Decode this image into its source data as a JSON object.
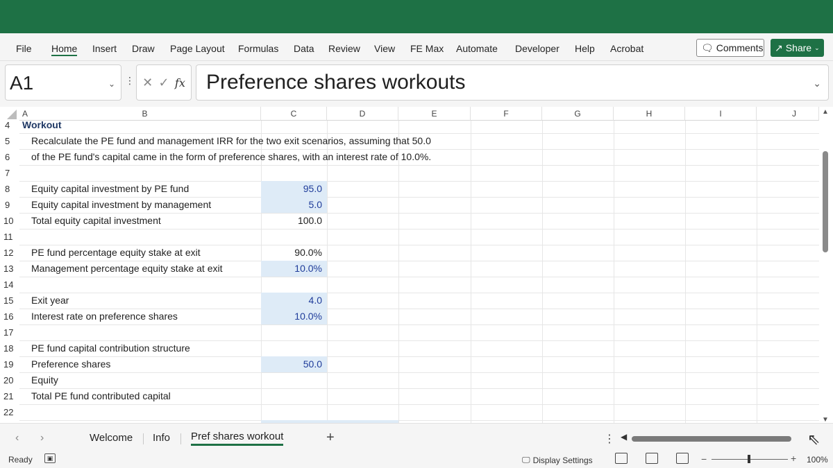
{
  "ribbon": {
    "tabs": [
      "File",
      "Home",
      "Insert",
      "Draw",
      "Page Layout",
      "Formulas",
      "Data",
      "Review",
      "View",
      "FE Max",
      "Automate",
      "Developer",
      "Help",
      "Acrobat"
    ],
    "active_tab": "Home",
    "comments_label": "Comments",
    "share_label": "Share"
  },
  "formula_bar": {
    "name_box": "A1",
    "fx": "fx",
    "formula": "Preference shares workouts"
  },
  "grid": {
    "columns": [
      "A",
      "B",
      "C",
      "D",
      "E",
      "F",
      "G",
      "H",
      "I",
      "J"
    ],
    "rows": [
      "4",
      "5",
      "6",
      "7",
      "8",
      "9",
      "10",
      "11",
      "12",
      "13",
      "14",
      "15",
      "16",
      "17",
      "18",
      "19",
      "20",
      "21",
      "22"
    ],
    "cells": {
      "r4_title": "Workout",
      "r5_text": "Recalculate the PE fund and management IRR for the two exit scenarios, assuming that 50.0",
      "r6_text": "of the PE fund's capital came in the form of preference shares, with an interest rate of 10.0%.",
      "r8_label": "Equity capital investment by PE fund",
      "r8_value": "95.0",
      "r9_label": "Equity capital investment by management",
      "r9_value": "5.0",
      "r10_label": "Total equity capital investment",
      "r10_value": "100.0",
      "r12_label": "PE fund percentage equity stake at exit",
      "r12_value": "90.0%",
      "r13_label": "Management percentage equity stake at exit",
      "r13_value": "10.0%",
      "r15_label": "Exit year",
      "r15_value": "4.0",
      "r16_label": "Interest rate on preference shares",
      "r16_value": "10.0%",
      "r18_label": "PE fund capital contribution structure",
      "r19_label": "Preference shares",
      "r19_value": "50.0",
      "r20_label": "Equity",
      "r21_label": "Total PE fund contributed capital"
    }
  },
  "sheet_tabs": {
    "tabs": [
      "Welcome",
      "Info",
      "Pref shares workout"
    ],
    "active": "Pref shares workout",
    "add": "+"
  },
  "status": {
    "ready": "Ready",
    "display_settings": "Display Settings",
    "zoom": "100%"
  },
  "colors": {
    "brand": "#1e7145",
    "input_fill": "#deebf7",
    "input_text": "#1f3c9a",
    "title_text": "#1f3864"
  }
}
